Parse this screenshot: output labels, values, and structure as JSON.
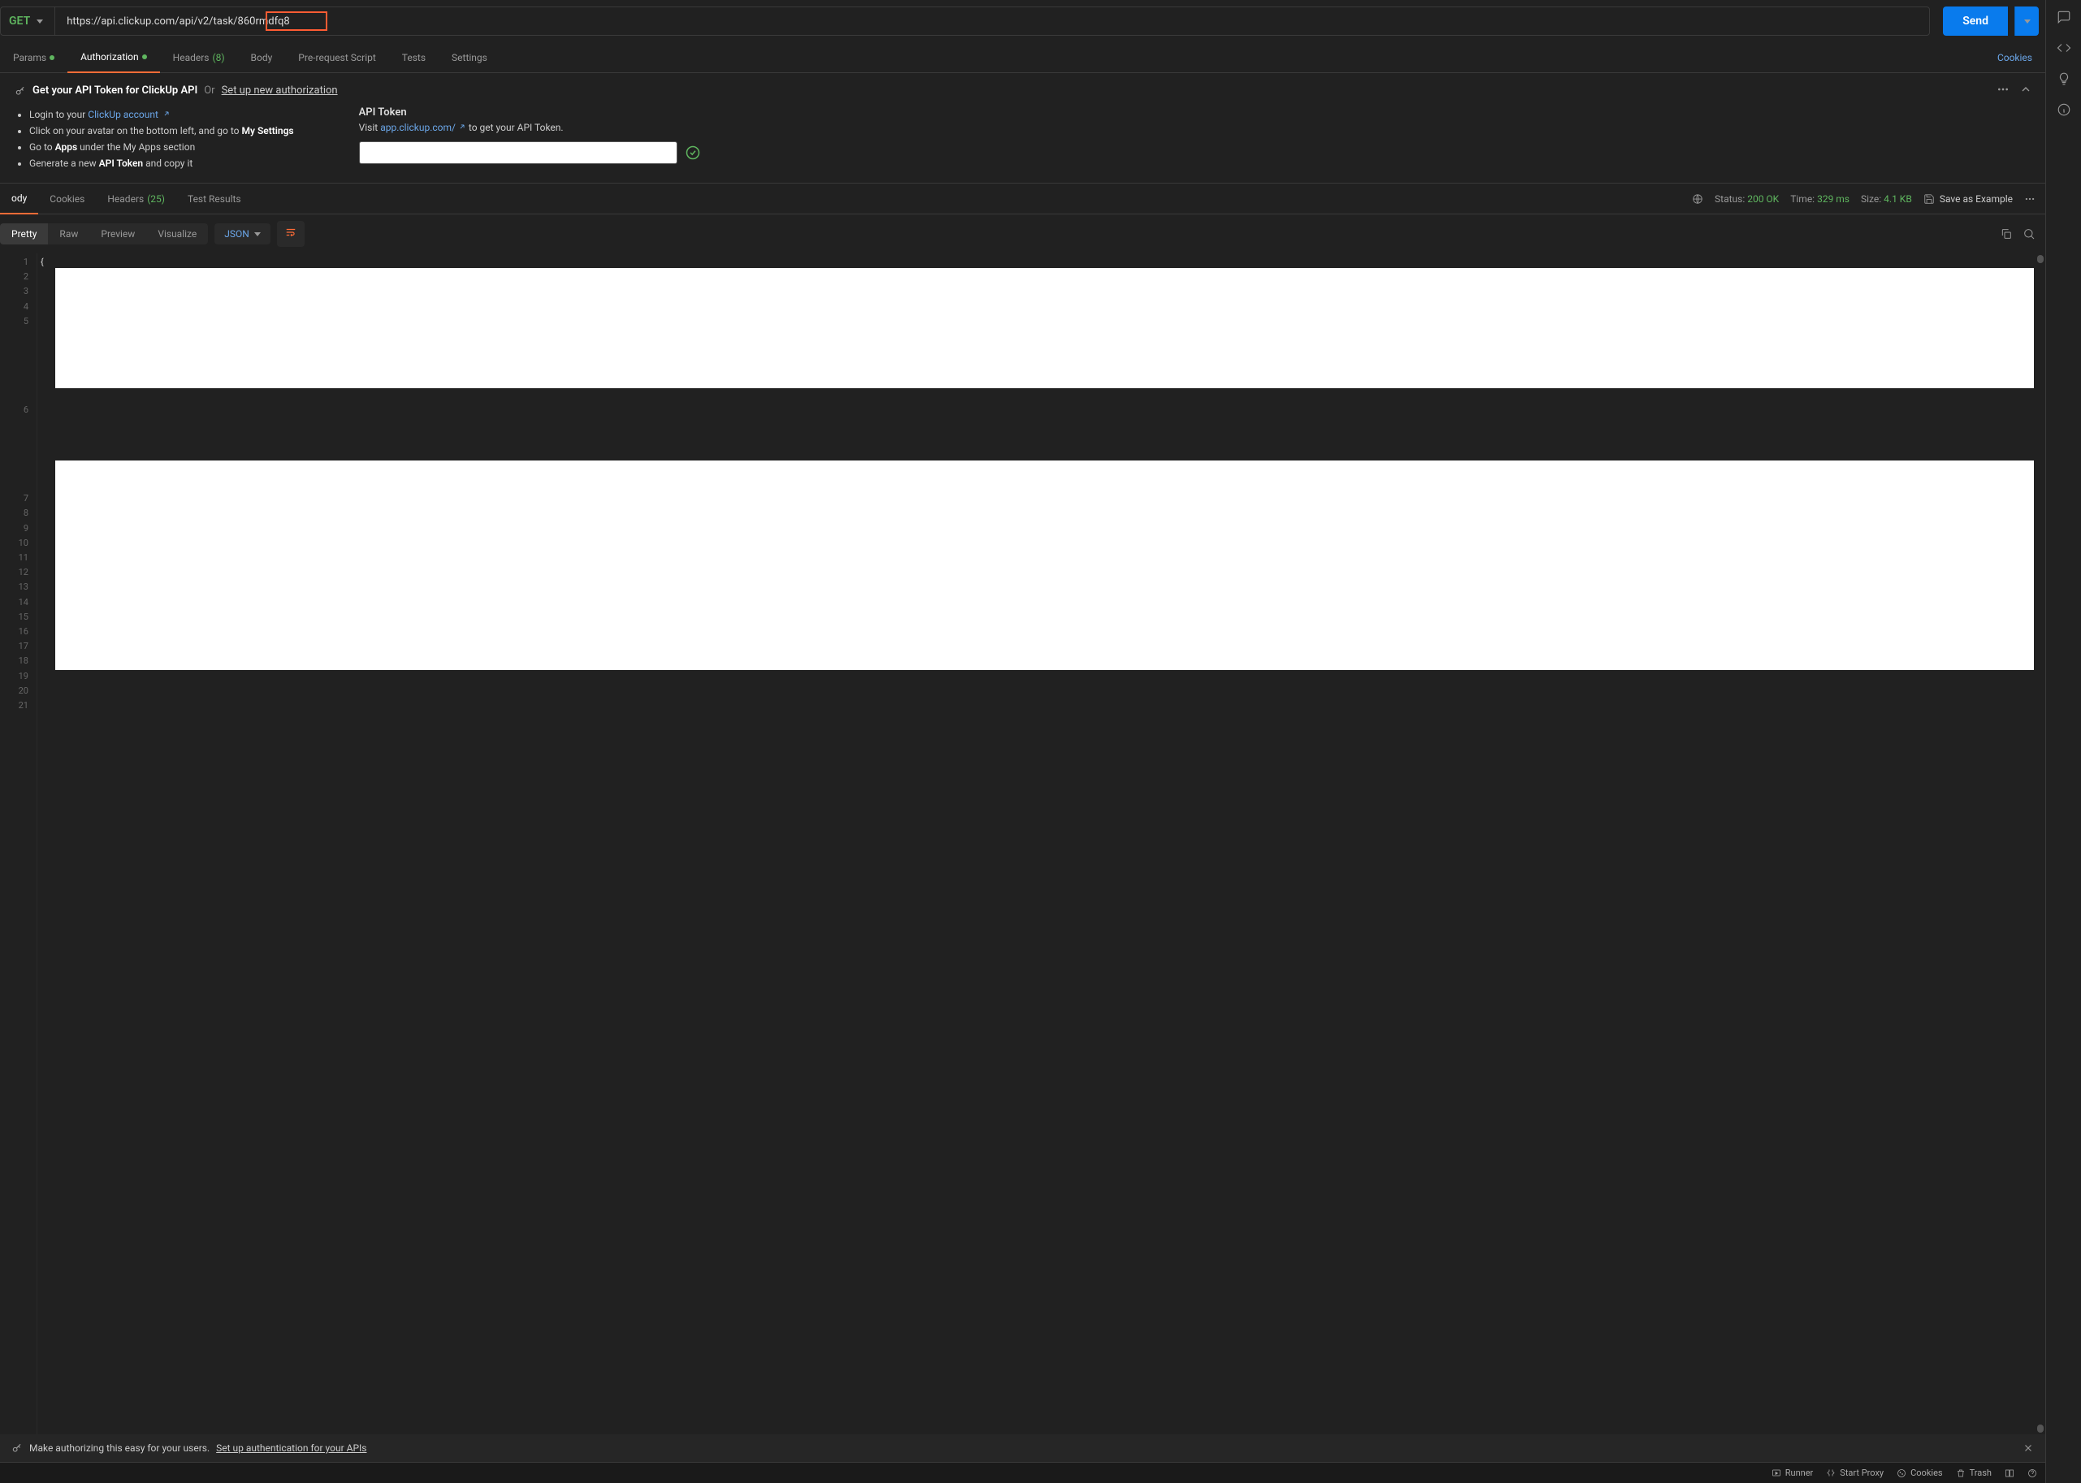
{
  "request": {
    "method": "GET",
    "url": "https://api.clickup.com/api/v2/task/860rmdfq8",
    "send": "Send"
  },
  "tabs": {
    "params": "Params",
    "auth": "Authorization",
    "headers": "Headers",
    "headers_count": "(8)",
    "body": "Body",
    "prerequest": "Pre-request Script",
    "tests": "Tests",
    "settings": "Settings",
    "cookies": "Cookies"
  },
  "auth": {
    "title": "Get your API Token for ClickUp API",
    "or": "Or",
    "setup_link": "Set up new authorization",
    "step1_prefix": "Login to your ",
    "step1_link": "ClickUp account",
    "step2_prefix": "Click on your avatar on the bottom left, and go to ",
    "step2_bold": "My Settings",
    "step3_prefix": "Go to ",
    "step3_bold": "Apps",
    "step3_suffix": " under the My Apps section",
    "step4_prefix": "Generate a new ",
    "step4_bold": "API Token",
    "step4_suffix": " and copy it",
    "token_title": "API Token",
    "token_visit": "Visit ",
    "token_link": "app.clickup.com/",
    "token_suffix": " to get your API Token."
  },
  "response": {
    "tabs": {
      "body": "ody",
      "cookies": "Cookies",
      "headers": "Headers",
      "headers_count": "(25)",
      "tests": "Test Results"
    },
    "status_label": "Status:",
    "status_value": "200 OK",
    "time_label": "Time:",
    "time_value": "329 ms",
    "size_label": "Size:",
    "size_value": "4.1 KB",
    "save_example": "Save as Example",
    "view": {
      "pretty": "Pretty",
      "raw": "Raw",
      "preview": "Preview",
      "visualize": "Visualize",
      "format": "JSON"
    },
    "line1": "{",
    "line_numbers": [
      "1",
      "2",
      "3",
      "4",
      "5",
      "6",
      "7",
      "8",
      "9",
      "10",
      "11",
      "12",
      "13",
      "14",
      "15",
      "16",
      "17",
      "18",
      "19",
      "20",
      "21"
    ]
  },
  "banner": {
    "text": "Make authorizing this easy for your users.",
    "link": "Set up authentication for your APIs"
  },
  "statusbar": {
    "runner": "Runner",
    "proxy": "Start Proxy",
    "cookies": "Cookies",
    "trash": "Trash"
  }
}
